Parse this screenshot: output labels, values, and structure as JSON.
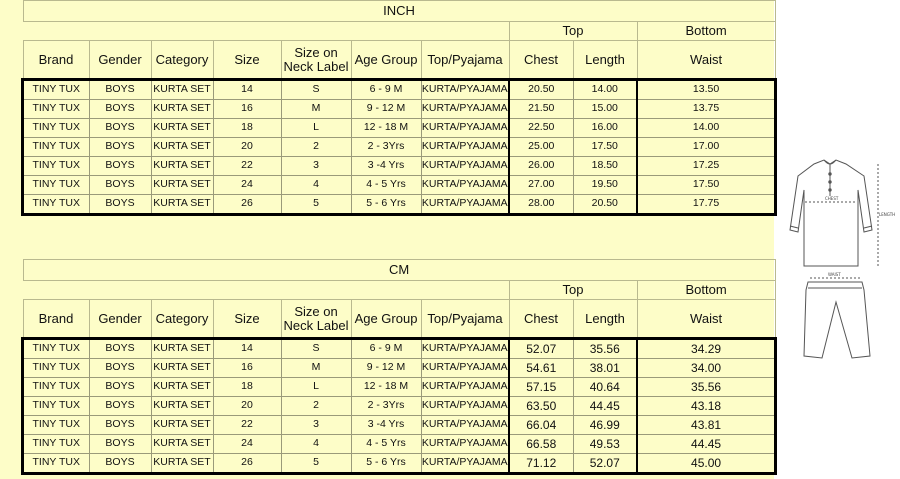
{
  "columns": {
    "brand": "Brand",
    "gender": "Gender",
    "category": "Category",
    "size": "Size",
    "neck_label_line1": "Size on",
    "neck_label_line2": "Neck Label",
    "age_group": "Age Group",
    "top_pyajama": "Top/Pyajama",
    "chest": "Chest",
    "length": "Length",
    "waist": "Waist",
    "group_top": "Top",
    "group_bottom": "Bottom"
  },
  "inch_table": {
    "title": "INCH",
    "rows": [
      [
        "TINY TUX",
        "BOYS",
        "KURTA SET",
        "14",
        "S",
        "6 - 9 M",
        "KURTA/PYAJAMA",
        "20.50",
        "14.00",
        "13.50"
      ],
      [
        "TINY TUX",
        "BOYS",
        "KURTA SET",
        "16",
        "M",
        "9 - 12 M",
        "KURTA/PYAJAMA",
        "21.50",
        "15.00",
        "13.75"
      ],
      [
        "TINY TUX",
        "BOYS",
        "KURTA SET",
        "18",
        "L",
        "12 - 18 M",
        "KURTA/PYAJAMA",
        "22.50",
        "16.00",
        "14.00"
      ],
      [
        "TINY TUX",
        "BOYS",
        "KURTA SET",
        "20",
        "2",
        "2 - 3Yrs",
        "KURTA/PYAJAMA",
        "25.00",
        "17.50",
        "17.00"
      ],
      [
        "TINY TUX",
        "BOYS",
        "KURTA SET",
        "22",
        "3",
        "3 -4 Yrs",
        "KURTA/PYAJAMA",
        "26.00",
        "18.50",
        "17.25"
      ],
      [
        "TINY TUX",
        "BOYS",
        "KURTA SET",
        "24",
        "4",
        "4 - 5 Yrs",
        "KURTA/PYAJAMA",
        "27.00",
        "19.50",
        "17.50"
      ],
      [
        "TINY TUX",
        "BOYS",
        "KURTA SET",
        "26",
        "5",
        "5 - 6 Yrs",
        "KURTA/PYAJAMA",
        "28.00",
        "20.50",
        "17.75"
      ]
    ]
  },
  "cm_table": {
    "title": "CM",
    "rows": [
      [
        "TINY TUX",
        "BOYS",
        "KURTA SET",
        "14",
        "S",
        "6 - 9 M",
        "KURTA/PYAJAMA",
        "52.07",
        "35.56",
        "34.29"
      ],
      [
        "TINY TUX",
        "BOYS",
        "KURTA SET",
        "16",
        "M",
        "9 - 12 M",
        "KURTA/PYAJAMA",
        "54.61",
        "38.01",
        "34.00"
      ],
      [
        "TINY TUX",
        "BOYS",
        "KURTA SET",
        "18",
        "L",
        "12 - 18 M",
        "KURTA/PYAJAMA",
        "57.15",
        "40.64",
        "35.56"
      ],
      [
        "TINY TUX",
        "BOYS",
        "KURTA SET",
        "20",
        "2",
        "2 - 3Yrs",
        "KURTA/PYAJAMA",
        "63.50",
        "44.45",
        "43.18"
      ],
      [
        "TINY TUX",
        "BOYS",
        "KURTA SET",
        "22",
        "3",
        "3 -4 Yrs",
        "KURTA/PYAJAMA",
        "66.04",
        "46.99",
        "43.81"
      ],
      [
        "TINY TUX",
        "BOYS",
        "KURTA SET",
        "24",
        "4",
        "4 - 5 Yrs",
        "KURTA/PYAJAMA",
        "66.58",
        "49.53",
        "44.45"
      ],
      [
        "TINY TUX",
        "BOYS",
        "KURTA SET",
        "26",
        "5",
        "5 - 6 Yrs",
        "KURTA/PYAJAMA",
        "71.12",
        "52.07",
        "45.00"
      ]
    ]
  },
  "illustration": {
    "chest_label": "CHEST",
    "length_label": "LENGTH",
    "waist_label": "WAIST"
  },
  "colors": {
    "sheet_background": "#fdfdc8",
    "grid_line": "#b9b98f",
    "data_border": "#000000"
  }
}
